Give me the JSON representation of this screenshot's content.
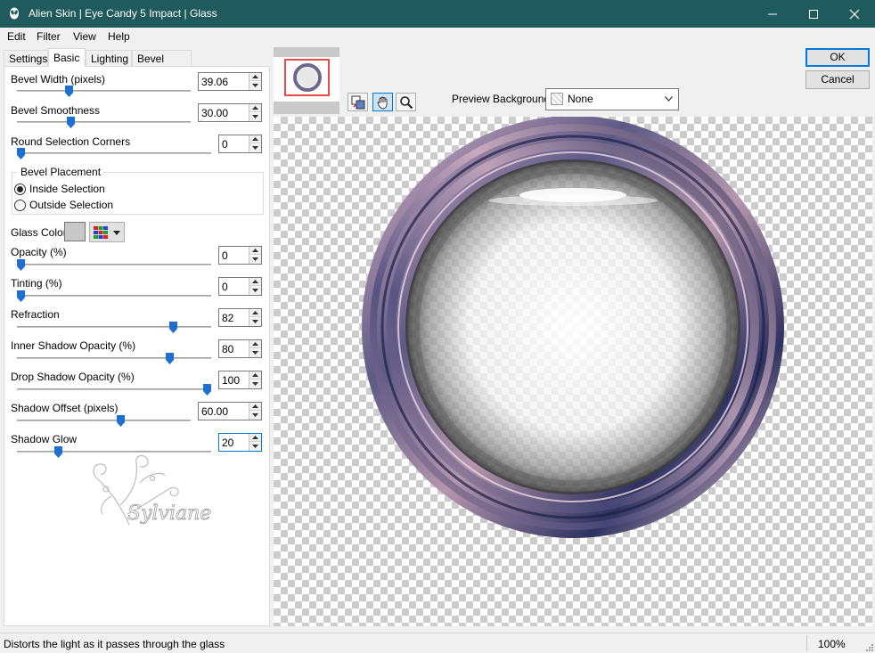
{
  "window": {
    "title": "Alien Skin | Eye Candy 5 Impact | Glass",
    "controls": {
      "minimize": "minimize",
      "maximize": "maximize",
      "close": "close"
    }
  },
  "menu": [
    "Edit",
    "Filter",
    "View",
    "Help"
  ],
  "tabs": [
    "Settings",
    "Basic",
    "Lighting",
    "Bevel Profile"
  ],
  "active_tab": "Basic",
  "controls": {
    "bevel_width": {
      "label": "Bevel Width (pixels)",
      "value": "39.06",
      "level": 0.29
    },
    "bevel_smoothness": {
      "label": "Bevel Smoothness",
      "value": "30.00",
      "level": 0.3
    },
    "round_corners": {
      "label": "Round Selection Corners",
      "value": "0",
      "level": 0.0
    },
    "opacity": {
      "label": "Opacity (%)",
      "value": "0",
      "level": 0.0
    },
    "tinting": {
      "label": "Tinting (%)",
      "value": "0",
      "level": 0.0
    },
    "refraction": {
      "label": "Refraction",
      "value": "82",
      "level": 0.82
    },
    "inner_shadow": {
      "label": "Inner Shadow Opacity (%)",
      "value": "80",
      "level": 0.8
    },
    "drop_shadow": {
      "label": "Drop Shadow Opacity (%)",
      "value": "100",
      "level": 1.0
    },
    "shadow_offset": {
      "label": "Shadow Offset (pixels)",
      "value": "60.00",
      "level": 0.6
    },
    "shadow_glow": {
      "label": "Shadow Glow",
      "value": "20",
      "level": 0.2
    }
  },
  "bevel_placement": {
    "title": "Bevel Placement",
    "inside": "Inside Selection",
    "outside": "Outside Selection",
    "selected": "inside"
  },
  "glass_color": {
    "label": "Glass Color",
    "swatch": "#c8c8c8"
  },
  "watermark": {
    "text": "Sylviane"
  },
  "preview_background": {
    "label": "Preview Background:",
    "value": "None"
  },
  "buttons": {
    "ok": "OK",
    "cancel": "Cancel"
  },
  "status": {
    "message": "Distorts the light as it passes through the glass",
    "zoom": "100%"
  },
  "colors": {
    "titlebar": "#1f5a5c",
    "accent": "#0078d7",
    "thumb": "#1e6fd0"
  }
}
